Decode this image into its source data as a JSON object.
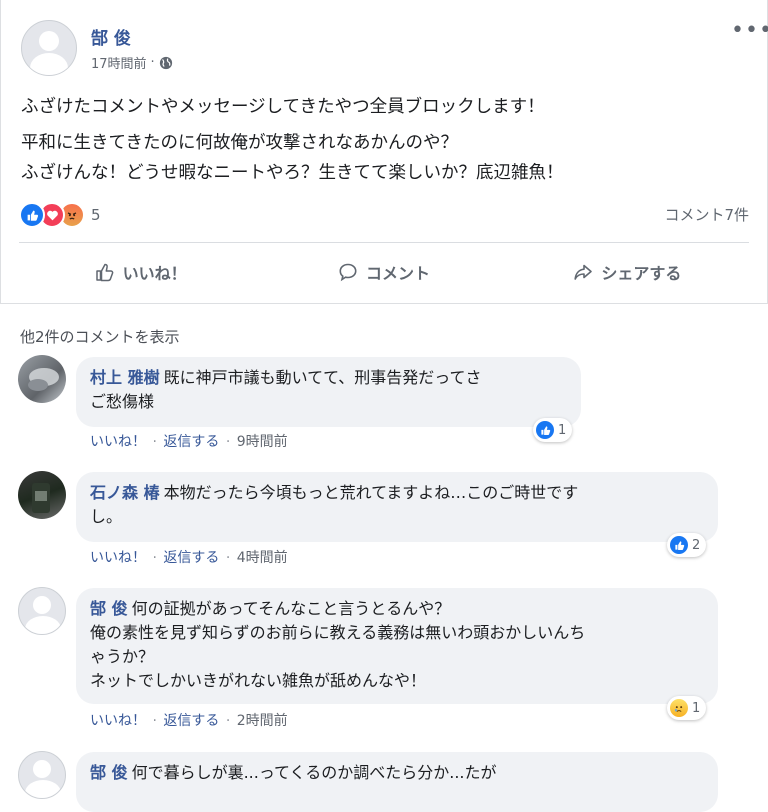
{
  "post": {
    "author": "郜 俊",
    "time": "17時間前",
    "meta_sep": "·",
    "more": "•••",
    "text": [
      "ふざけたコメントやメッセージしてきたやつ全員ブロックします！",
      "平和に生きてきたのに何故俺が攻撃されなあかんのや？",
      "ふざけんな！どうせ暇なニートやろ？生きてて楽しいか？底辺雑魚！"
    ],
    "reaction_count": "5",
    "comment_count": "コメント7件",
    "actions": {
      "like": "いいね！",
      "comment": "コメント",
      "share": "シェアする"
    }
  },
  "comments_section": {
    "more_comments": "他2件のコメントを表示",
    "meta_like": "いいね！",
    "meta_reply": "返信する",
    "meta_sep": "·",
    "items": [
      {
        "name": "村上 雅樹",
        "lines": [
          "既に神戸市議も動いてて、刑事告発だってさ",
          "ご愁傷様"
        ],
        "time": "9時間前",
        "reaction_count": "1"
      },
      {
        "name": "石ノ森 椿",
        "lines": [
          "本物だったら今頃もっと荒れてますよね…このご時世です",
          "し。"
        ],
        "time": "4時間前",
        "reaction_count": "2"
      },
      {
        "name": "郜 俊",
        "lines": [
          "何の証拠があってそんなこと言うとるんや？",
          "俺の素性を見ず知らずのお前らに教える義務は無いわ頭おかしいんち",
          "ゃうか？",
          "ネットでしかいきがれない雑魚が舐めんなや！"
        ],
        "time": "2時間前",
        "reaction_count": "1"
      },
      {
        "name": "郜 俊",
        "lines": [
          "何で暮らしが裏...ってくるのか調べたら分か...たが"
        ]
      }
    ]
  },
  "colors": {
    "link": "#385898",
    "like_blue": "#1877f2",
    "love_red": "#f33e58",
    "bubble_bg": "#f0f2f5",
    "text": "#1c1e21",
    "muted": "#606770"
  },
  "icons": [
    "more-icon",
    "globe-icon",
    "like-reaction-icon",
    "love-reaction-icon",
    "angry-reaction-icon",
    "thumbs-up-icon",
    "comment-icon",
    "share-icon",
    "sad-reaction-icon"
  ]
}
